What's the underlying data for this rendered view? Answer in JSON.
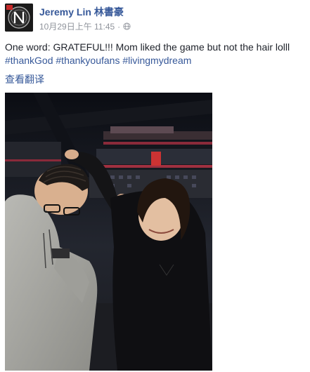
{
  "post": {
    "author": "Jeremy Lin 林書豪",
    "timestamp": "10月29日上午 11:45",
    "separator": "·",
    "text": "One word: GRATEFUL!!! Mom liked the game but not the hair lolll",
    "hashtags": [
      "#thankGod",
      "#thankyoufans",
      "#livingmydream"
    ],
    "translate_label": "查看翻译",
    "privacy_icon": "globe-icon"
  },
  "colors": {
    "link": "#365899",
    "meta": "#90949c",
    "text": "#1d2129"
  }
}
